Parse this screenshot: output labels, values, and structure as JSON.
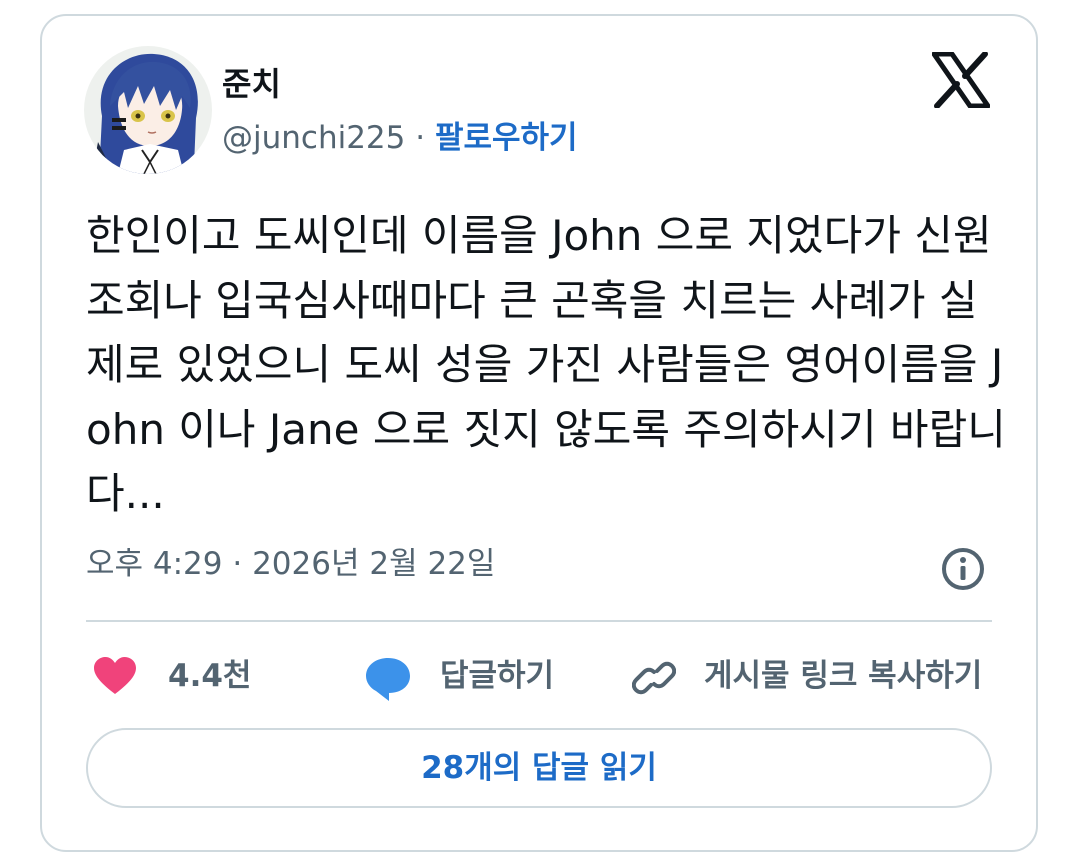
{
  "author": {
    "display_name": "준치",
    "handle": "@junchi225",
    "separator": " · ",
    "follow_label": "팔로우하기"
  },
  "tweet": {
    "text": "한인이고 도씨인데 이름을 John 으로 지었다가 신원조회나 입국심사때마다 큰 곤혹을 치르는 사례가 실제로 있었으니 도씨 성을 가진 사람들은 영어이름을 John 이나 Jane 으로 짓지 않도록 주의하시기 바랍니다...",
    "time": "오후 4:29",
    "meta_separator": " · ",
    "date": "2026년 2월 22일"
  },
  "actions": {
    "like_count": "4.4천",
    "reply_label": "답글하기",
    "copy_link_label": "게시물 링크 복사하기"
  },
  "read_replies_label": "28개의 답글 읽기",
  "icons": {
    "logo": "x-logo-icon",
    "info": "info-icon",
    "like": "heart-icon",
    "reply": "speech-bubble-icon",
    "link": "link-icon"
  },
  "colors": {
    "accent": "#1d6bc7",
    "heart": "#f0437b",
    "reply_bubble": "#3c92ea",
    "muted_text": "#536471",
    "border": "#cfd9de"
  }
}
